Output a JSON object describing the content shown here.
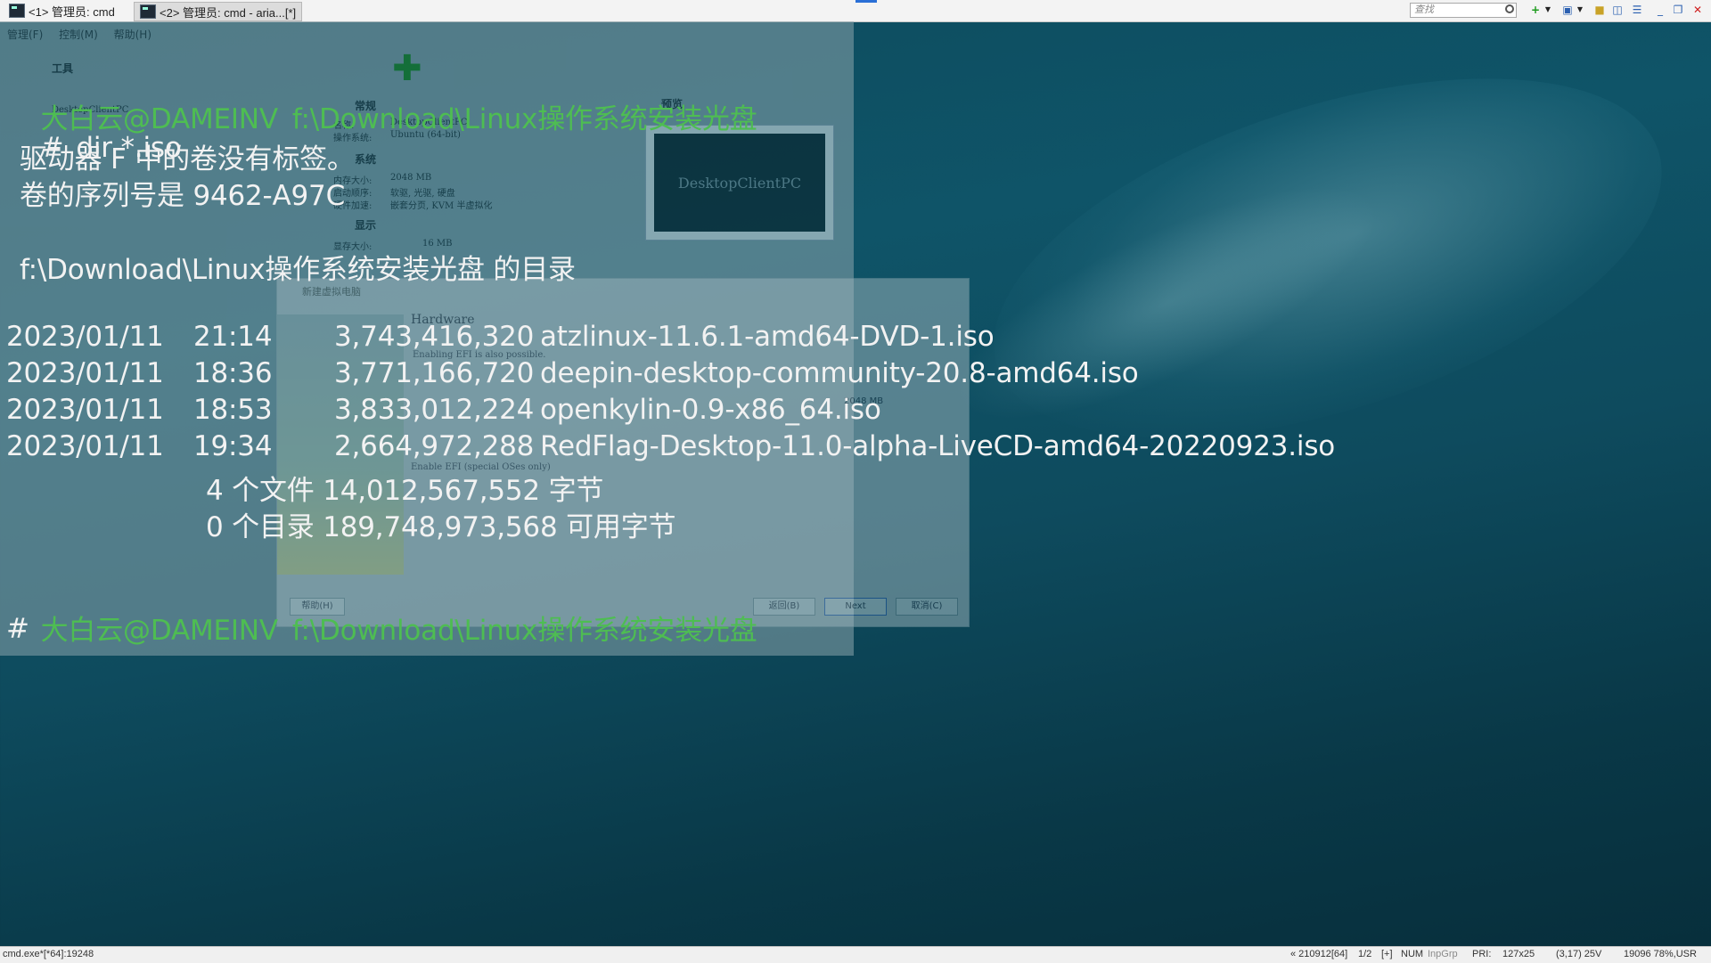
{
  "tabs": [
    {
      "label": "<1> 管理员: cmd"
    },
    {
      "label": "<2> 管理员: cmd - aria...[*]"
    }
  ],
  "toolbar": {
    "search_placeholder": "查找"
  },
  "background_window": {
    "menu": "管理(F)  控制(M)  帮助(H)",
    "tools_label": "工具",
    "vm_name": "DesktopClientPC",
    "section_general": "常规",
    "name_label": "名称:",
    "name_value": "DesktopClientPC",
    "os_label": "操作系统:",
    "os_value": "Ubuntu (64-bit)",
    "section_system": "系统",
    "mem_label": "内存大小:",
    "mem_value": "2048 MB",
    "boot_label": "启动顺序:",
    "boot_value": "软驱, 光驱, 硬盘",
    "accel_label": "硬件加速:",
    "accel_value": "嵌套分页, KVM 半虚拟化",
    "section_display": "显示",
    "vram_label": "显存大小:",
    "vram_value": "16 MB",
    "section_preview": "预览",
    "preview_text": "DesktopClientPC"
  },
  "dialog": {
    "title": "新建虚拟电脑",
    "heading": "Hardware",
    "efi_note": "Enabling EFI is also possible.",
    "efi_checkbox": "Enable EFI (special OSes only)",
    "mem_value": "2048 MB",
    "help_button": "帮助(H)",
    "back_button": "返回(B)",
    "next_button": "Next",
    "cancel_button": "取消(C)"
  },
  "console": {
    "prompt_user": "大白云@DAMEINV",
    "prompt_path": "f:\\Download\\Linux操作系统安装光盘",
    "prompt_symbol": "#",
    "command": "dir *.iso",
    "volume_label_line": "驱动器 F 中的卷没有标签。",
    "serial_line": "卷的序列号是 9462-A97C",
    "directory_line": "f:\\Download\\Linux操作系统安装光盘 的目录",
    "files": [
      {
        "date": "2023/01/11",
        "time": "21:14",
        "size": "3,743,416,320",
        "name": "atzlinux-11.6.1-amd64-DVD-1.iso"
      },
      {
        "date": "2023/01/11",
        "time": "18:36",
        "size": "3,771,166,720",
        "name": "deepin-desktop-community-20.8-amd64.iso"
      },
      {
        "date": "2023/01/11",
        "time": "18:53",
        "size": "3,833,012,224",
        "name": "openkylin-0.9-x86_64.iso"
      },
      {
        "date": "2023/01/11",
        "time": "19:34",
        "size": "2,664,972,288",
        "name": "RedFlag-Desktop-11.0-alpha-LiveCD-amd64-20220923.iso"
      }
    ],
    "summary_files": "4 个文件 14,012,567,552 字节",
    "summary_dirs": "0 个目录 189,748,973,568 可用字节"
  },
  "statusbar": {
    "left": "cmd.exe*[*64]:19248",
    "session": "« 210912[64]",
    "page": "1/2",
    "plus": "[+]",
    "num": "NUM",
    "inpgrp": "InpGrp",
    "pri": "PRI:",
    "size": "127x25",
    "cursor": "(3,17) 25V",
    "mem": "19096 78%,USR"
  },
  "colors": {
    "prompt_green": "#4ebd52",
    "console_text": "#f2f2f2",
    "desktop_teal": "#0f5468"
  }
}
